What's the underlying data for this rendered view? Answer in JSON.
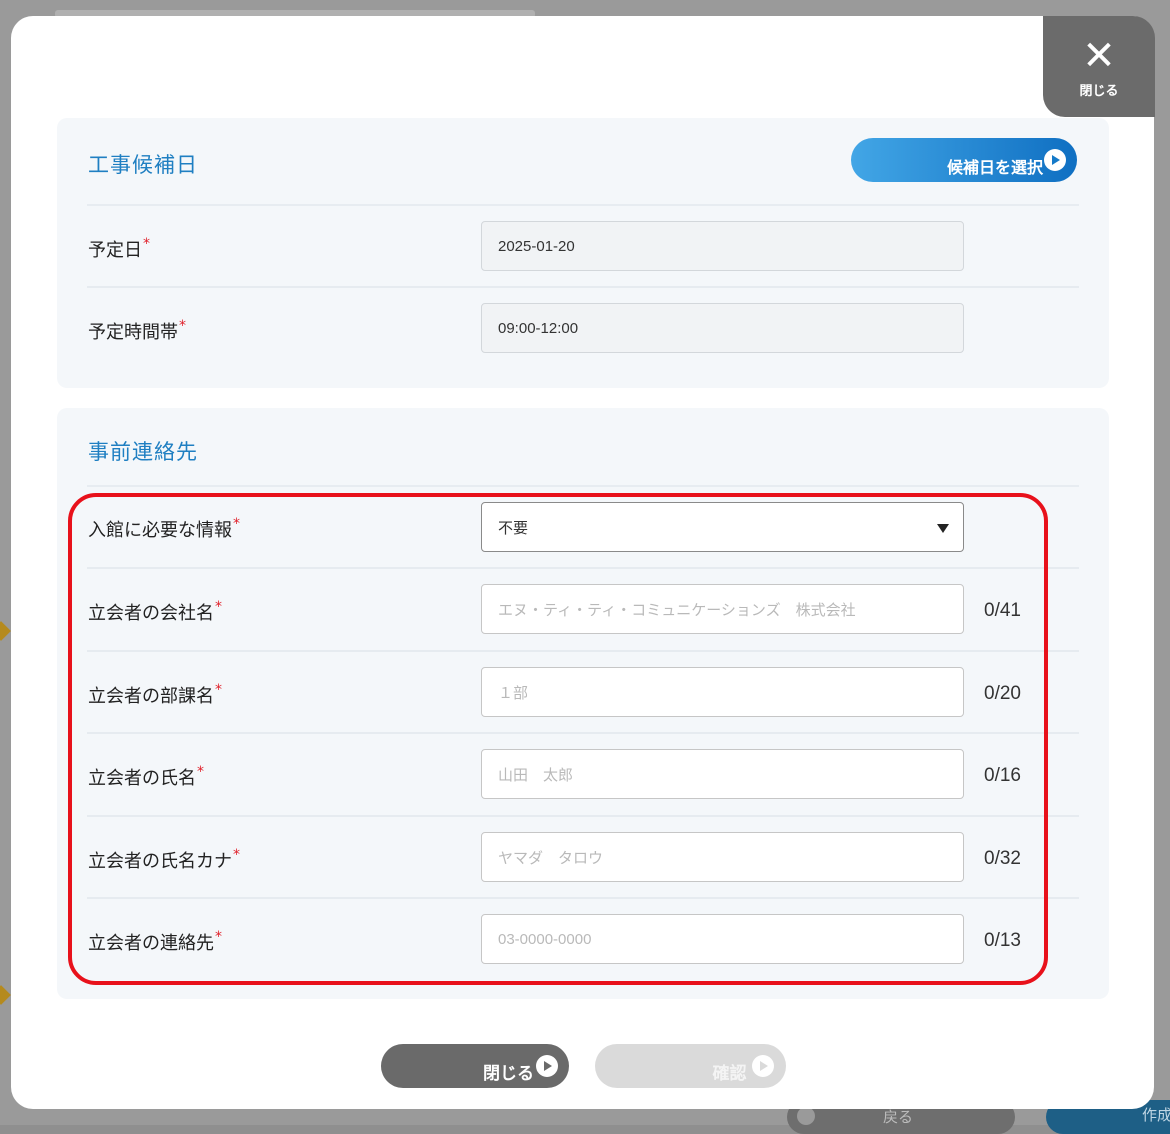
{
  "background": {
    "back_label": "戻る",
    "create_label": "作成"
  },
  "modal": {
    "close_label": "閉じる"
  },
  "schedule": {
    "title": "工事候補日",
    "select_button": "候補日を選択",
    "rows": [
      {
        "label": "予定日",
        "required": "*",
        "value": "2025-01-20"
      },
      {
        "label": "予定時間帯",
        "required": "*",
        "value": "09:00-12:00"
      }
    ]
  },
  "contact": {
    "title": "事前連絡先",
    "entry_info": {
      "label": "入館に必要な情報",
      "required": "*",
      "selected": "不要"
    },
    "fields": [
      {
        "label": "立会者の会社名",
        "required": "*",
        "placeholder": "エヌ・ティ・ティ・コミュニケーションズ　株式会社",
        "counter": "0/41"
      },
      {
        "label": "立会者の部課名",
        "required": "*",
        "placeholder": "１部",
        "counter": "0/20"
      },
      {
        "label": "立会者の氏名",
        "required": "*",
        "placeholder": "山田　太郎",
        "counter": "0/16"
      },
      {
        "label": "立会者の氏名カナ",
        "required": "*",
        "placeholder": "ヤマダ　タロウ",
        "counter": "0/32"
      },
      {
        "label": "立会者の連絡先",
        "required": "*",
        "placeholder": "03-0000-0000",
        "counter": "0/13"
      }
    ]
  },
  "footer": {
    "close_button": "閉じる",
    "confirm_button": "確認"
  },
  "colors": {
    "accent": "#1f7fc2",
    "required": "#e0202a",
    "highlight": "#e8111b"
  }
}
